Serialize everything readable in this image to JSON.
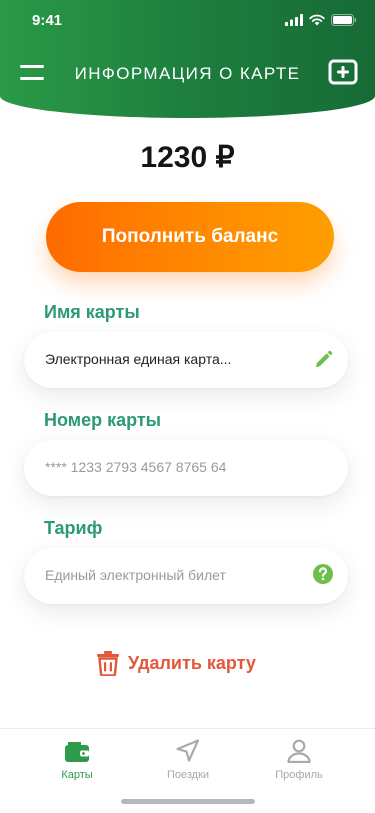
{
  "status_bar": {
    "time": "9:41"
  },
  "header": {
    "title": "ИНФОРМАЦИЯ О КАРТЕ",
    "menu_icon": "hamburger-menu-icon",
    "add_icon": "add-card-icon"
  },
  "balance": {
    "amount": "1230 ₽"
  },
  "topup_button": {
    "label": "Пополнить баланс"
  },
  "fields": {
    "card_name": {
      "label": "Имя карты",
      "value": "Электронная единая карта...",
      "icon": "pencil-icon"
    },
    "card_number": {
      "label": "Номер карты",
      "value": "**** 1233 2793 4567 8765 64"
    },
    "tariff": {
      "label": "Тариф",
      "value": "Единый электронный билет",
      "icon": "help-icon"
    }
  },
  "delete_button": {
    "label": "Удалить карту",
    "icon": "trash-icon"
  },
  "tabbar": {
    "tabs": [
      {
        "label": "Карты",
        "icon": "wallet-icon",
        "active": true
      },
      {
        "label": "Поездки",
        "icon": "navigation-arrow-icon",
        "active": false
      },
      {
        "label": "Профиль",
        "icon": "profile-icon",
        "active": false
      }
    ]
  },
  "colors": {
    "header_green": "#1d7c3d",
    "accent_orange": "#ff7a00",
    "label_teal": "#2c9a74",
    "delete_red": "#e4573a",
    "active_tab_green": "#2f9a4a",
    "help_green": "#6cc04a"
  }
}
